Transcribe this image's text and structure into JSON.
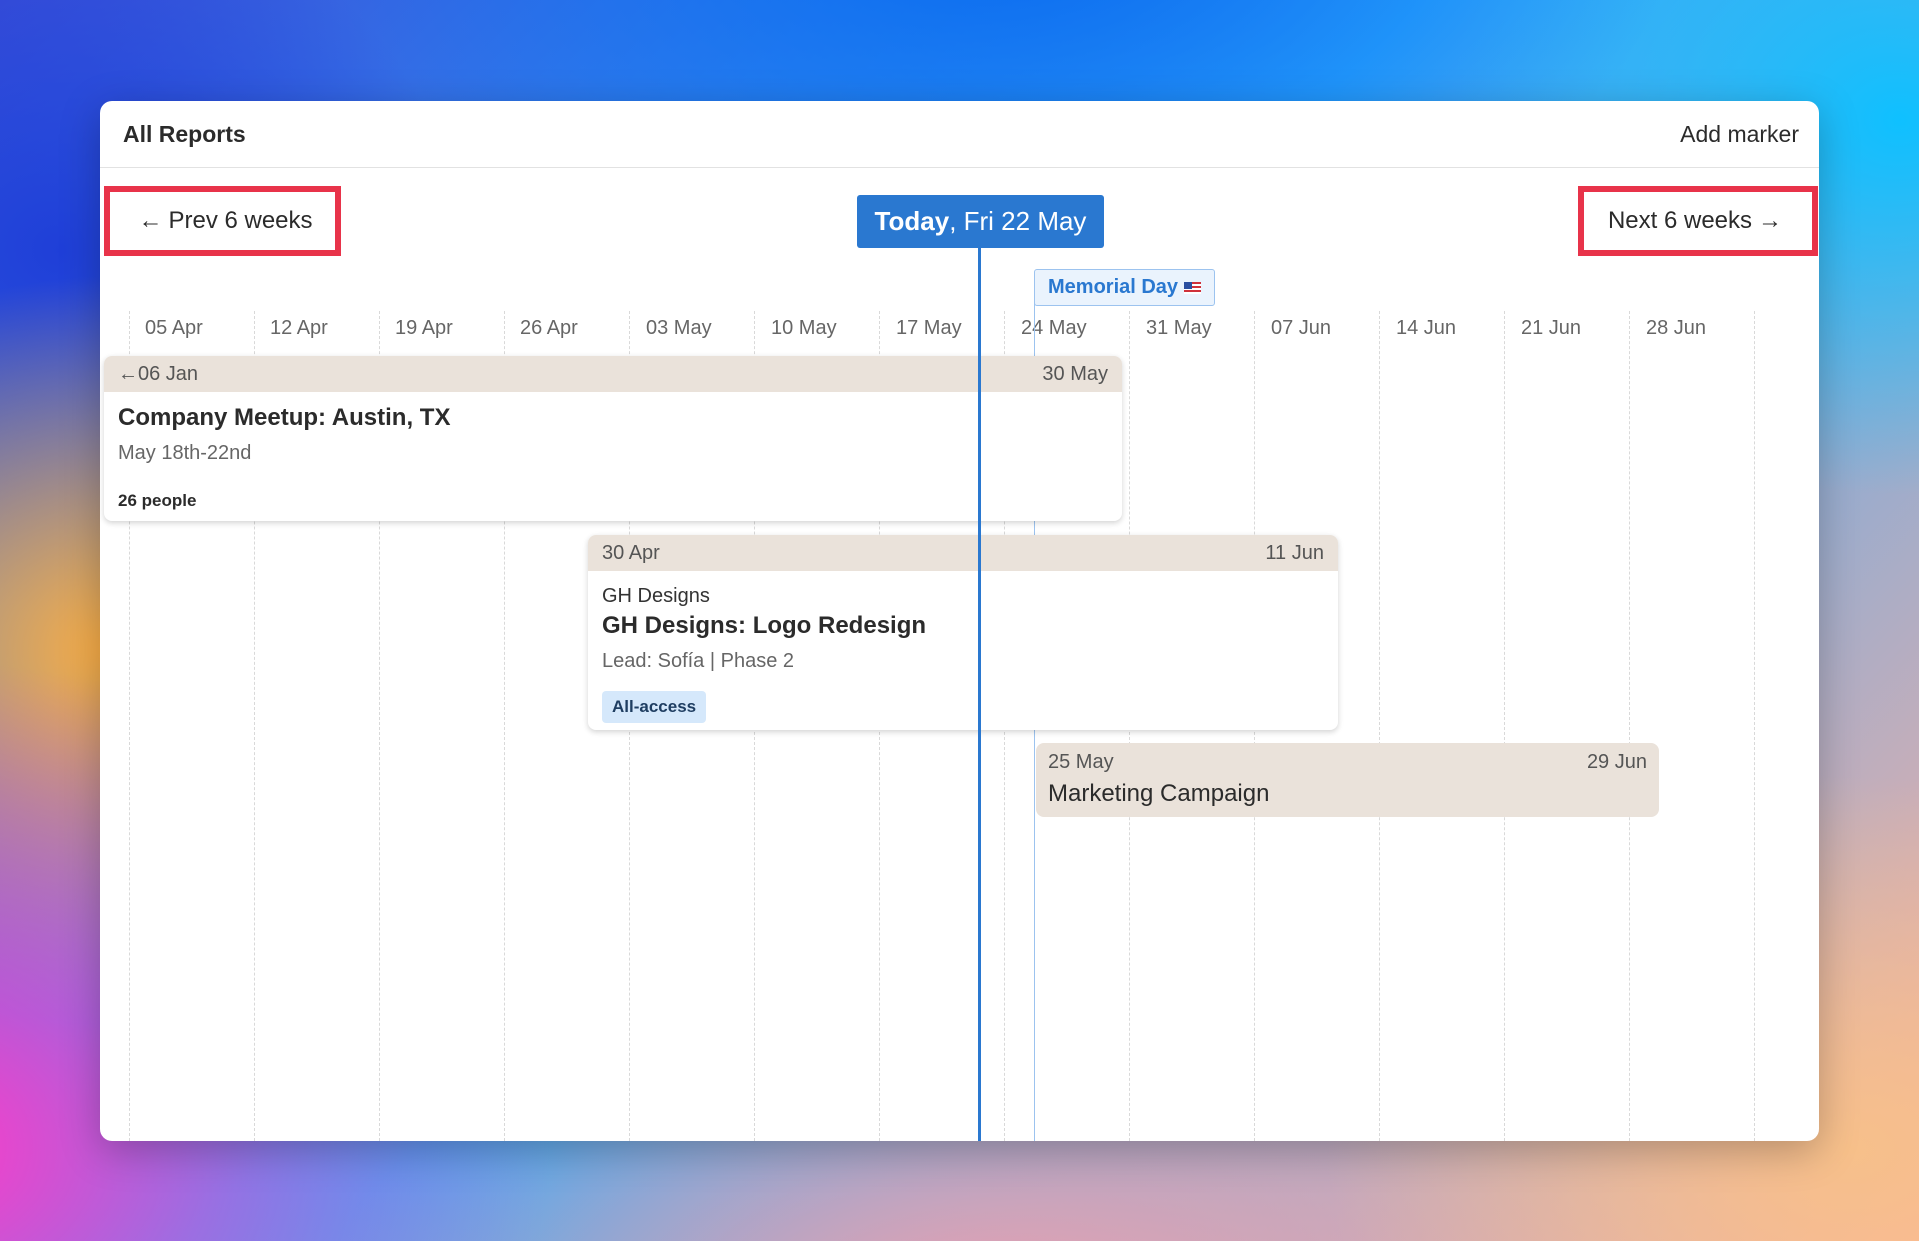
{
  "header": {
    "title": "All Reports",
    "add_marker": "Add marker"
  },
  "nav": {
    "prev_label": "Prev 6 weeks",
    "next_label": "Next 6 weeks",
    "prev_arrow": "←",
    "next_arrow": "→"
  },
  "today": {
    "bold": "Today",
    "rest": ", Fri 22 May"
  },
  "marker": {
    "label": "Memorial Day"
  },
  "columns": [
    "05 Apr",
    "12 Apr",
    "19 Apr",
    "26 Apr",
    "03 May",
    "10 May",
    "17 May",
    "24 May",
    "31 May",
    "07 Jun",
    "14 Jun",
    "21 Jun",
    "28 Jun"
  ],
  "events": [
    {
      "start": "←06 Jan",
      "end": "30 May",
      "title": "Company Meetup: Austin, TX",
      "subtitle": "May 18th-22nd",
      "meta": "26 people"
    },
    {
      "start": "30 Apr",
      "end": "11 Jun",
      "client": "GH Designs",
      "title": "GH Designs: Logo Redesign",
      "subtitle": "Lead: Sofía | Phase 2",
      "tag": "All-access"
    },
    {
      "start": "25 May",
      "end": "29 Jun",
      "title": "Marketing Campaign"
    }
  ]
}
